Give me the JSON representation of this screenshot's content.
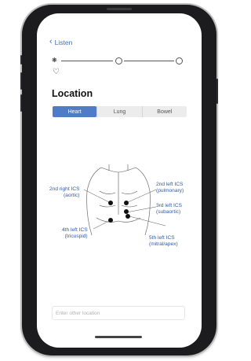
{
  "nav": {
    "back_label": "Listen"
  },
  "progress": {
    "steps": [
      "step-1",
      "step-2",
      "step-3"
    ],
    "current_step": 1,
    "heart_icon": "heart-outline-icon"
  },
  "page": {
    "title": "Location"
  },
  "segments": [
    {
      "label": "Heart",
      "active": true
    },
    {
      "label": "Lung",
      "active": false
    },
    {
      "label": "Bowel",
      "active": false
    }
  ],
  "diagram": {
    "labels": {
      "right_2nd": [
        "2nd right ICS",
        "(aortic)"
      ],
      "left_2nd": [
        "2nd left ICS",
        "(pulmonary)"
      ],
      "left_3rd": [
        "3rd left ICS",
        "(subaortic)"
      ],
      "left_4th": [
        "4th left ICS",
        "(tricuspid)"
      ],
      "left_5th": [
        "5th left ICS",
        "(mitral/apex)"
      ]
    }
  },
  "other_location": {
    "placeholder": "Enter other location"
  },
  "colors": {
    "accent": "#4f7cc4",
    "label": "#2f5aa5",
    "frame": "#1c1c1e"
  }
}
